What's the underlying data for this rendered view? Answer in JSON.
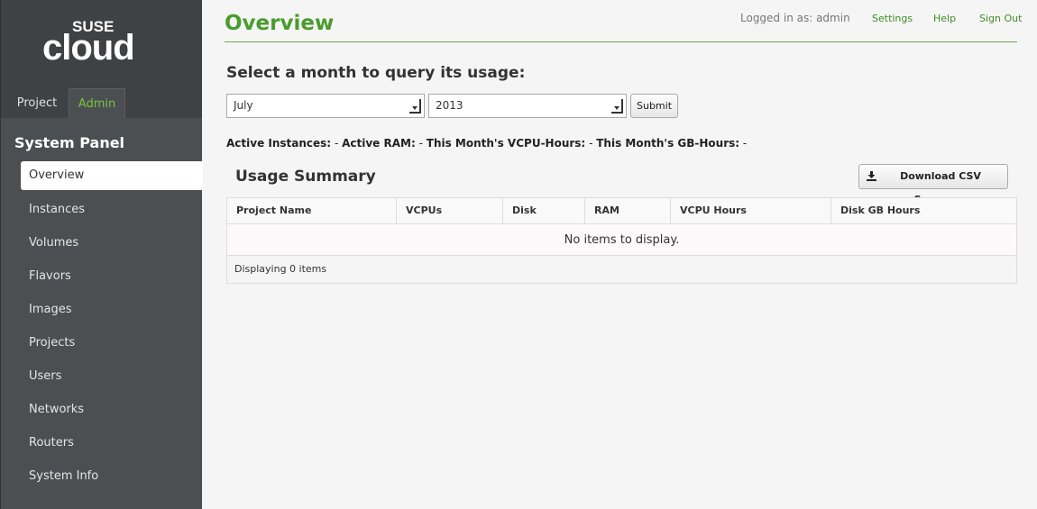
{
  "brand": {
    "logo_top": "SUSE",
    "logo_main": "cloud"
  },
  "tabs": [
    {
      "label": "Project"
    },
    {
      "label": "Admin"
    }
  ],
  "sidebar": {
    "panel_title": "System Panel",
    "items": [
      {
        "label": "Overview"
      },
      {
        "label": "Instances"
      },
      {
        "label": "Volumes"
      },
      {
        "label": "Flavors"
      },
      {
        "label": "Images"
      },
      {
        "label": "Projects"
      },
      {
        "label": "Users"
      },
      {
        "label": "Networks"
      },
      {
        "label": "Routers"
      },
      {
        "label": "System Info"
      }
    ]
  },
  "header": {
    "title": "Overview",
    "logged_in": "Logged in as: admin",
    "links": {
      "settings": "Settings",
      "help": "Help",
      "sign_out": "Sign Out"
    }
  },
  "query": {
    "title": "Select a month to query its usage:",
    "month": "July",
    "year": "2013",
    "submit_label": "Submit"
  },
  "stats": {
    "active_instances_label": "Active Instances:",
    "active_instances_value": "-",
    "active_ram_label": "Active RAM:",
    "active_ram_value": "-",
    "vcpu_hours_label": "This Month's VCPU-Hours:",
    "vcpu_hours_value": "-",
    "gb_hours_label": "This Month's GB-Hours:",
    "gb_hours_value": "-"
  },
  "usage": {
    "title": "Usage Summary",
    "download_label": "Download CSV Summary",
    "columns": [
      "Project Name",
      "VCPUs",
      "Disk",
      "RAM",
      "VCPU Hours",
      "Disk GB Hours"
    ],
    "empty_message": "No items to display.",
    "footer": "Displaying 0 items"
  },
  "colors": {
    "accent": "#4a9c2e",
    "sidebar": "#4b4f51",
    "link": "#3f8f27"
  }
}
